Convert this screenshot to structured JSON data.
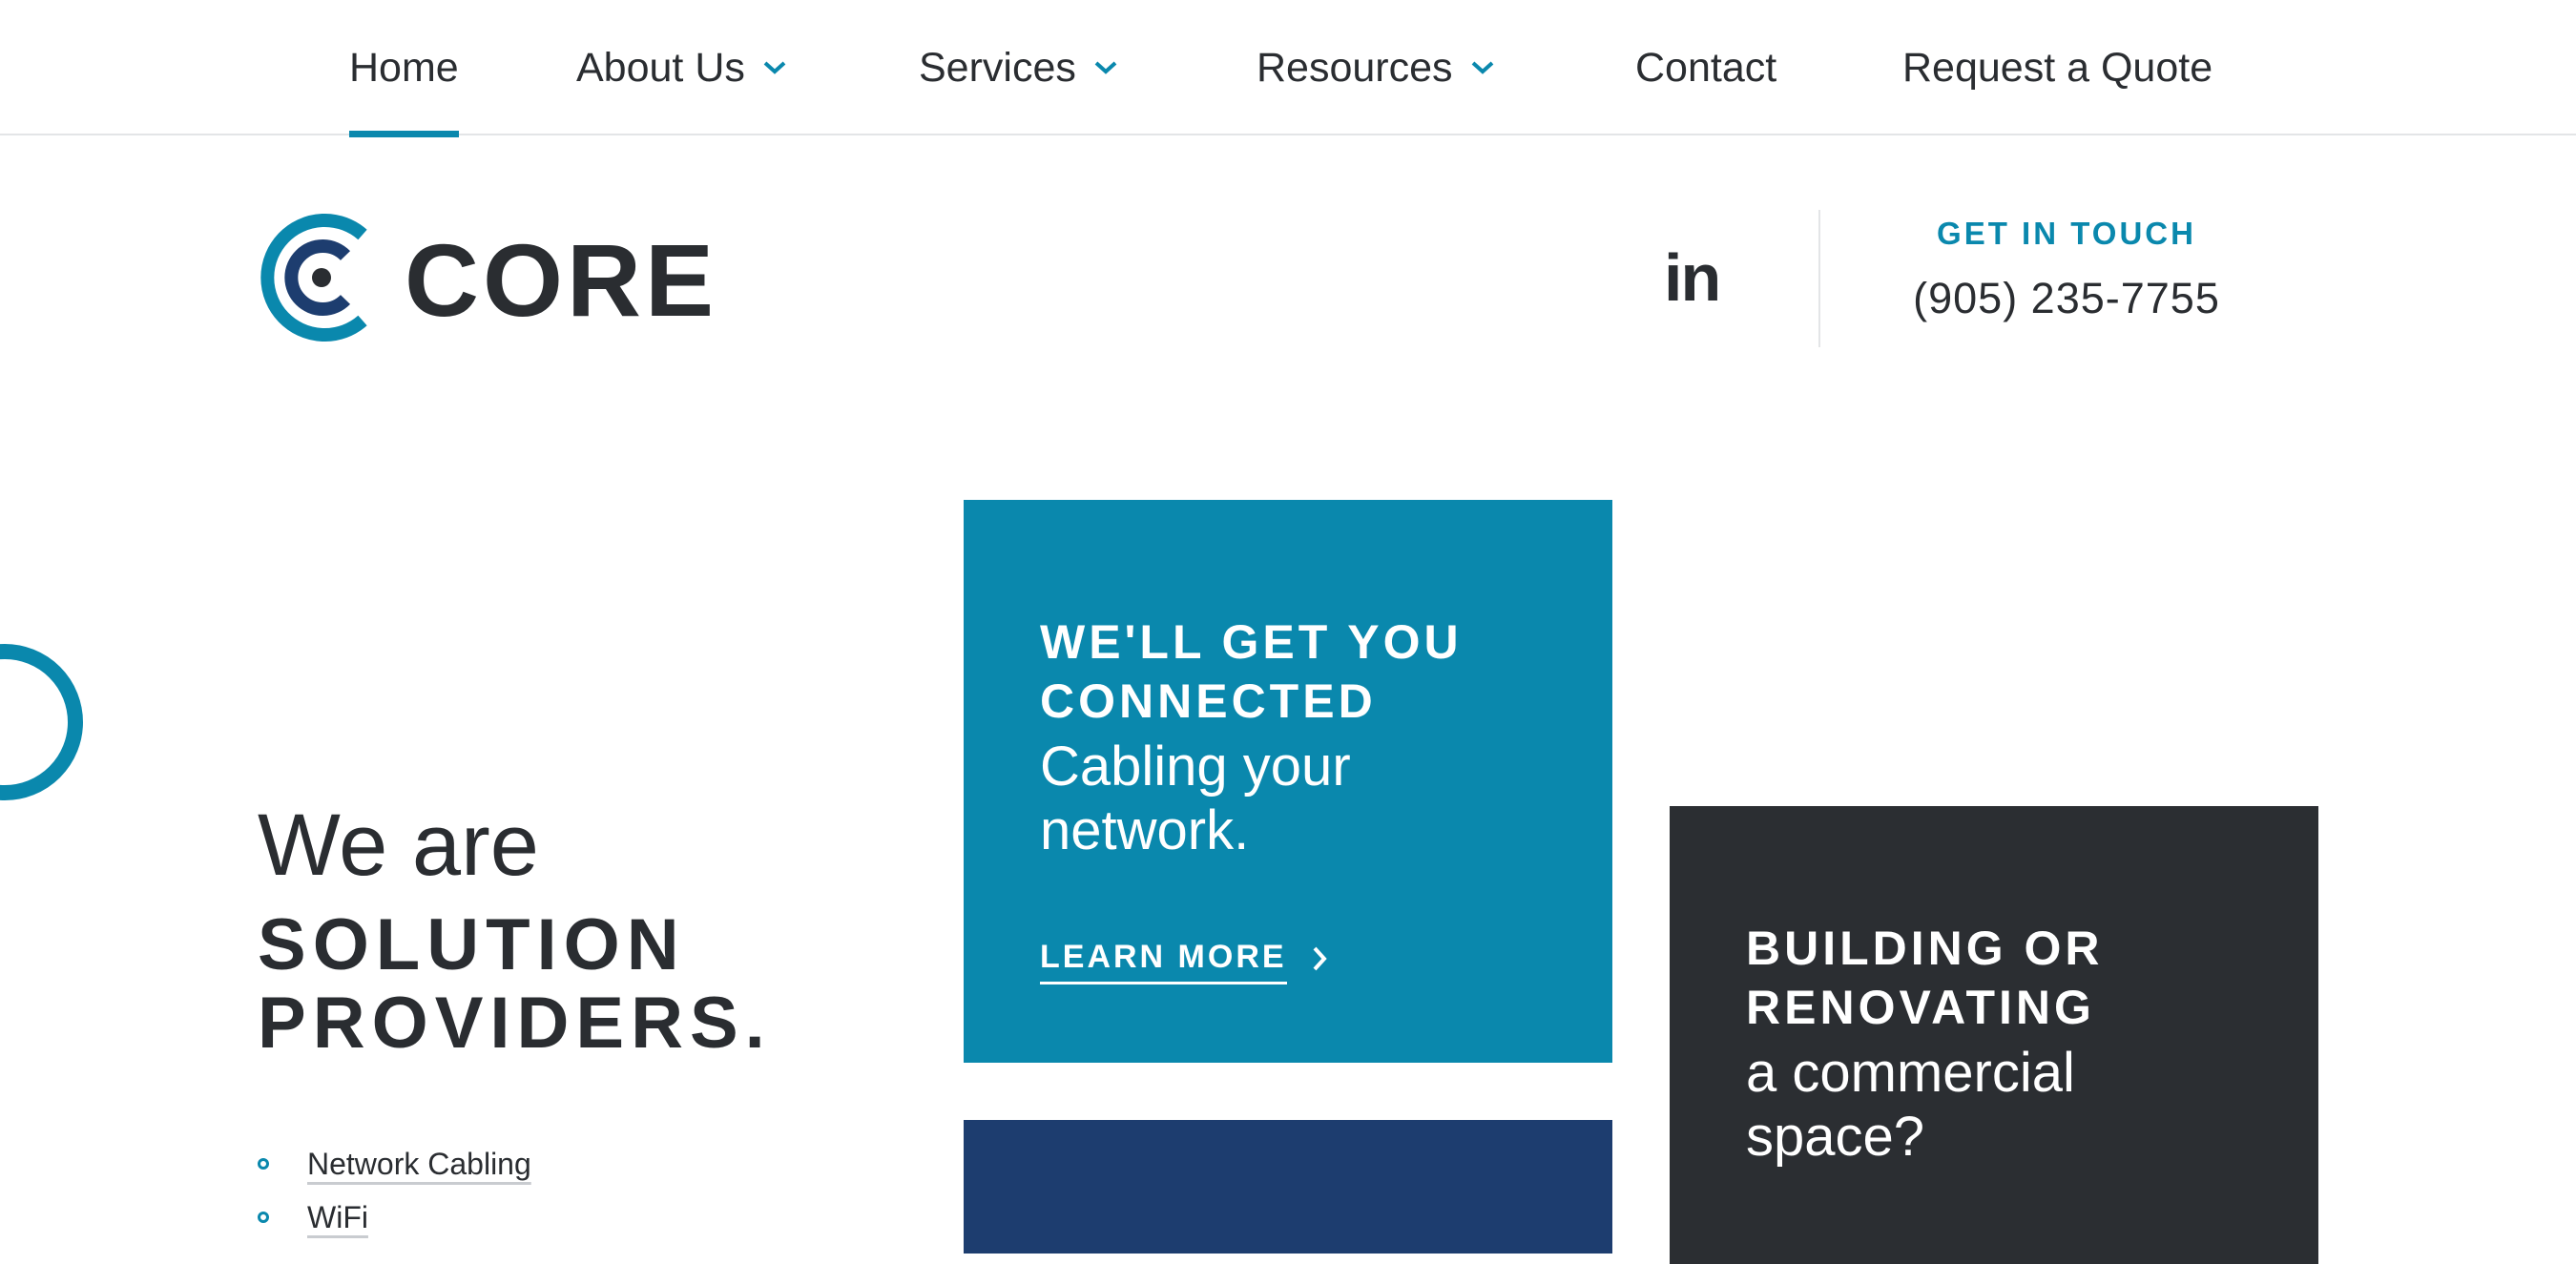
{
  "nav": {
    "items": [
      {
        "label": "Home",
        "active": true,
        "dropdown": false
      },
      {
        "label": "About Us",
        "active": false,
        "dropdown": true
      },
      {
        "label": "Services",
        "active": false,
        "dropdown": true
      },
      {
        "label": "Resources",
        "active": false,
        "dropdown": true
      },
      {
        "label": "Contact",
        "active": false,
        "dropdown": false
      },
      {
        "label": "Request a Quote",
        "active": false,
        "dropdown": false
      }
    ]
  },
  "header": {
    "logo_text": "CORE",
    "social_icon": "linkedin-icon",
    "linkedin_text": "in",
    "contact_label": "GET IN TOUCH",
    "phone": "(905) 235-7755"
  },
  "hero": {
    "line1": "We are",
    "line2": "SOLUTION",
    "line3": "PROVIDERS.",
    "services": [
      "Network Cabling",
      "WiFi"
    ]
  },
  "cards": {
    "connected": {
      "heading_line1": "WE'LL GET YOU",
      "heading_line2": "CONNECTED",
      "sub_line1": "Cabling your",
      "sub_line2": "network.",
      "cta": "LEARN MORE"
    },
    "building": {
      "heading_line1": "BUILDING OR",
      "heading_line2": "RENOVATING",
      "sub_line1": "a commercial",
      "sub_line2": "space?"
    }
  },
  "colors": {
    "accent": "#0a88ad",
    "navy": "#1d3d6f",
    "dark": "#2b2e32",
    "text": "#2a2d31"
  }
}
